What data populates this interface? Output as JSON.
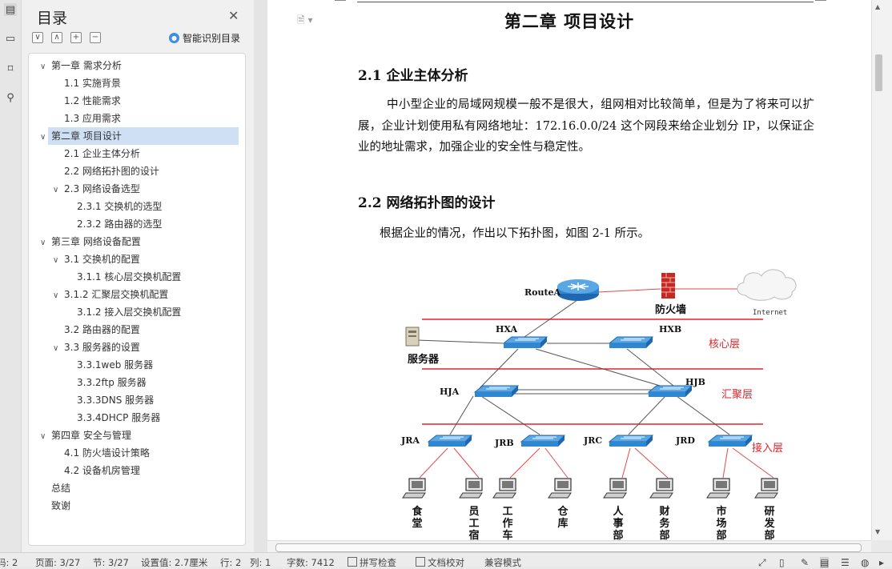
{
  "toc": {
    "title": "目录",
    "smart_label": "智能识别目录",
    "tools": [
      "∨",
      "∧",
      "+",
      "−"
    ],
    "items": [
      {
        "label": "第一章 需求分析",
        "level": 1,
        "expanded": true
      },
      {
        "label": "1.1 实施背景",
        "level": 2
      },
      {
        "label": "1.2 性能需求",
        "level": 2
      },
      {
        "label": "1.3 应用需求",
        "level": 2
      },
      {
        "label": "第二章 项目设计",
        "level": 1,
        "expanded": true,
        "selected": true
      },
      {
        "label": "2.1 企业主体分析",
        "level": 2
      },
      {
        "label": "2.2 网络拓扑图的设计",
        "level": 2
      },
      {
        "label": "2.3 网络设备选型",
        "level": 2,
        "expanded": true
      },
      {
        "label": "2.3.1 交换机的选型",
        "level": 3
      },
      {
        "label": "2.3.2 路由器的选型",
        "level": 3
      },
      {
        "label": "第三章 网络设备配置",
        "level": 1,
        "expanded": true
      },
      {
        "label": "3.1 交换机的配置",
        "level": 2,
        "expanded": true
      },
      {
        "label": "3.1.1 核心层交换机配置",
        "level": 3
      },
      {
        "label": "3.1.2 汇聚层交换机配置",
        "level": 2,
        "expanded": true
      },
      {
        "label": "3.1.2 接入层交换机配置",
        "level": 3
      },
      {
        "label": "3.2 路由器的配置",
        "level": 2
      },
      {
        "label": "3.3 服务器的设置",
        "level": 2,
        "expanded": true
      },
      {
        "label": "3.3.1web 服务器",
        "level": 3
      },
      {
        "label": "3.3.2ftp 服务器",
        "level": 3
      },
      {
        "label": "3.3.3DNS 服务器",
        "level": 3
      },
      {
        "label": "3.3.4DHCP 服务器",
        "level": 3
      },
      {
        "label": "第四章 安全与管理",
        "level": 1,
        "expanded": true
      },
      {
        "label": "4.1 防火墙设计策略",
        "level": 2
      },
      {
        "label": "4.2 设备机房管理",
        "level": 2
      },
      {
        "label": "总结",
        "level": 1
      },
      {
        "label": "致谢",
        "level": 1
      }
    ]
  },
  "document": {
    "chapter_title": "第二章  项目设计",
    "section1_heading": "2.1 企业主体分析",
    "section1_paragraph": "中小型企业的局域网规模一般不是很大，组网相对比较简单，但是为了将来可以扩展，企业计划使用私有网络地址：172.16.0.0/24 这个网段来给企业划分 IP，以保证企业的地址需求，加强企业的安全性与稳定性。",
    "section2_heading": "2.2 网络拓扑图的设计",
    "section2_paragraph": "根据企业的情况，作出以下拓扑图，如图 2-1 所示。"
  },
  "diagram": {
    "router_label": "RouteA",
    "firewall_label": "防火墙",
    "internet_label": "Internet",
    "server_label": "服务器",
    "core_switches": [
      "HXA",
      "HXB"
    ],
    "agg_switches": [
      "HJA",
      "HJB"
    ],
    "access_switches": [
      "JRA",
      "JRB",
      "JRC",
      "JRD"
    ],
    "layers": [
      "核心层",
      "汇聚层",
      "接入层"
    ],
    "pcs": [
      "食堂",
      "员工宿",
      "工作车",
      "仓库",
      "人事部",
      "财务部",
      "市场部",
      "研发部"
    ],
    "colors": {
      "layer_line": "#e8202a",
      "layer_text": "#d9262c",
      "link_red": "#e34a4a",
      "link_gray": "#555555",
      "switch_blue": "#2f86d1"
    }
  },
  "status": {
    "section_prefix": "码: 2",
    "page": "页面: 3/27",
    "sect": "节: 3/27",
    "setting": "设置值: 2.7厘米",
    "row": "行: 2",
    "col": "列: 1",
    "words": "字数: 7412",
    "spell": "拼写检查",
    "proof": "文档校对",
    "compat": "兼容模式"
  }
}
